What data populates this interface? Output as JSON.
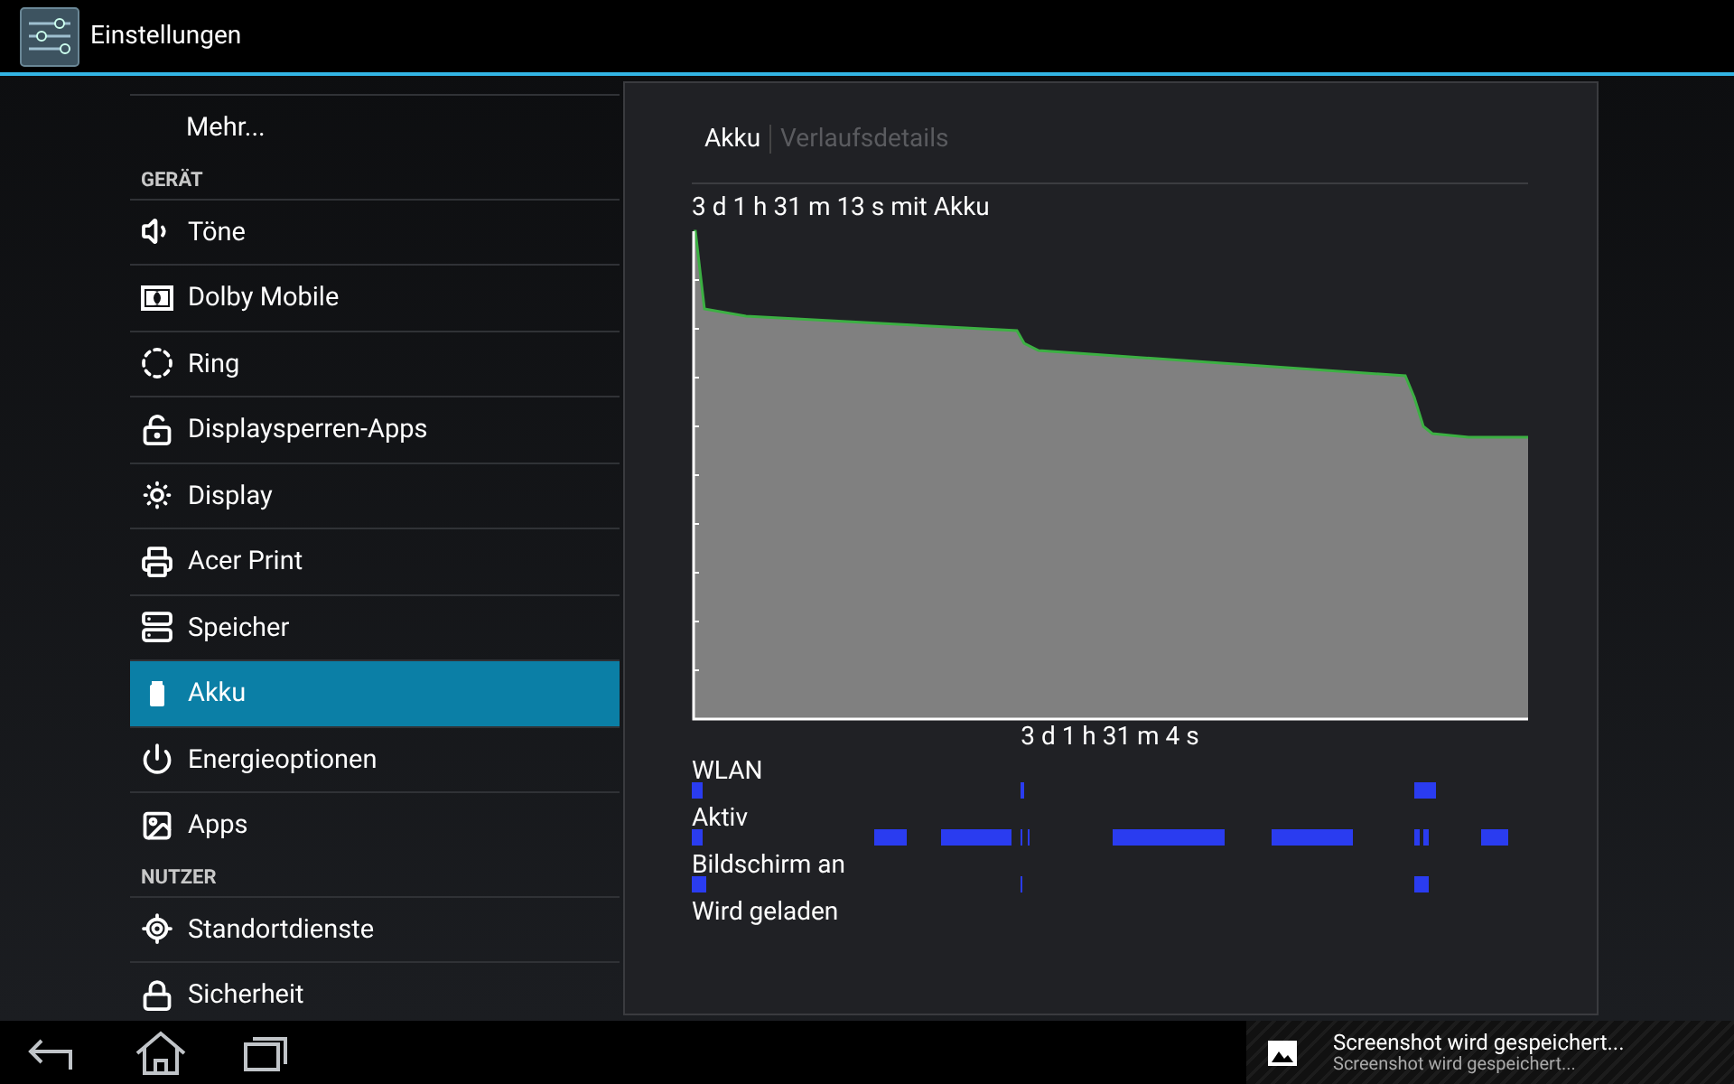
{
  "action_bar": {
    "title": "Einstellungen"
  },
  "sidebar": {
    "items": [
      {
        "kind": "item",
        "label": "Mehr...",
        "selected": false
      },
      {
        "kind": "header",
        "label": "GERÄT"
      },
      {
        "kind": "item",
        "label": "Töne",
        "selected": false
      },
      {
        "kind": "item",
        "label": "Dolby Mobile",
        "selected": false
      },
      {
        "kind": "item",
        "label": "Ring",
        "selected": false
      },
      {
        "kind": "item",
        "label": "Displaysperren-Apps",
        "selected": false
      },
      {
        "kind": "item",
        "label": "Display",
        "selected": false
      },
      {
        "kind": "item",
        "label": "Acer Print",
        "selected": false
      },
      {
        "kind": "item",
        "label": "Speicher",
        "selected": false
      },
      {
        "kind": "item",
        "label": "Akku",
        "selected": true
      },
      {
        "kind": "item",
        "label": "Energieoptionen",
        "selected": false
      },
      {
        "kind": "item",
        "label": "Apps",
        "selected": false
      },
      {
        "kind": "header",
        "label": "NUTZER"
      },
      {
        "kind": "item",
        "label": "Standortdienste",
        "selected": false
      },
      {
        "kind": "item",
        "label": "Sicherheit",
        "selected": false
      }
    ]
  },
  "detail": {
    "tabs": [
      {
        "label": "Akku",
        "selected": true
      },
      {
        "label": "Verlaufsdetails",
        "selected": false
      }
    ],
    "duration": "3 d 1 h 31 m 13 s mit Akku",
    "axis_label": "3 d 1 h 31 m 4 s",
    "activity_rows": [
      {
        "label": "WLAN"
      },
      {
        "label": "Aktiv"
      },
      {
        "label": "Bildschirm an"
      },
      {
        "label": "Wird geladen"
      }
    ]
  },
  "notification": {
    "title": "Screenshot wird gespeichert...",
    "text": "Screenshot wird gespeichert..."
  }
}
